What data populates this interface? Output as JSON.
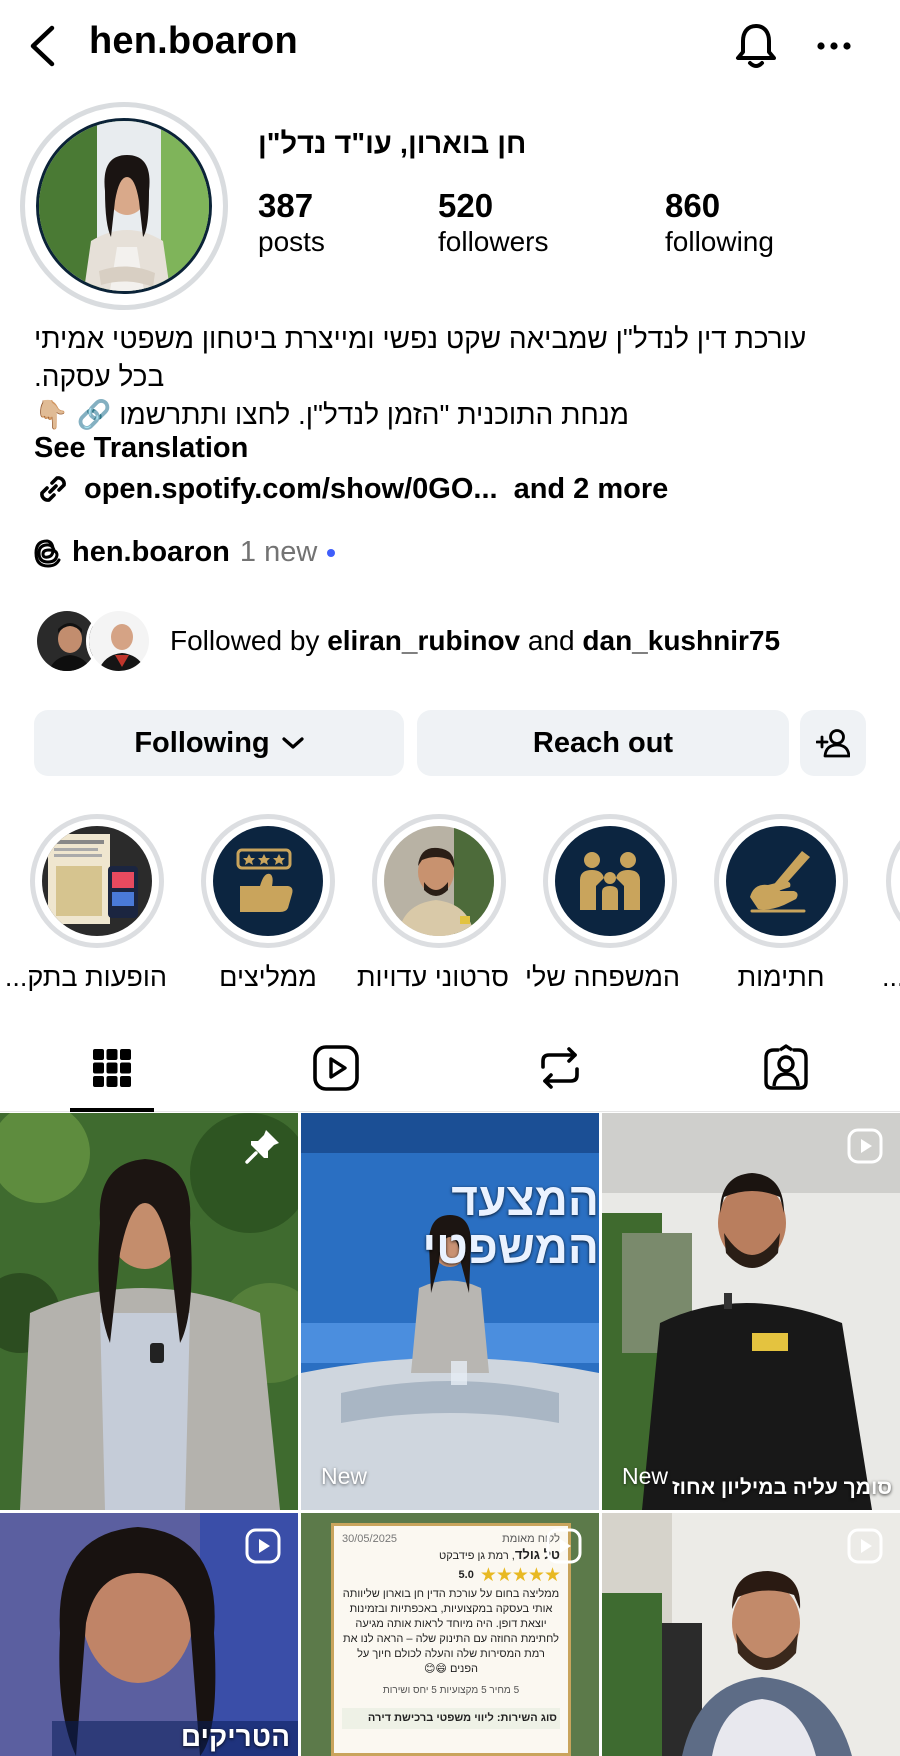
{
  "header": {
    "username": "hen.boaron"
  },
  "profile": {
    "display_name": "חן בוארון, עו\"ד נדל\"ן",
    "stats": [
      {
        "value": "387",
        "label": "posts"
      },
      {
        "value": "520",
        "label": "followers"
      },
      {
        "value": "860",
        "label": "following"
      }
    ],
    "bio_lines": [
      "עורכת דין לנדל\"ן שמביאה שקט נפשי ומייצרת ביטחון משפטי אמיתי",
      "בכל עסקה.",
      "מנחת התוכנית \"הזמן לנדל\"ן. לחצו ותתרשמו 🔗 👇🏼"
    ],
    "see_translation": "See Translation",
    "link_text": "open.spotify.com/show/0GO...",
    "link_more": "and 2 more",
    "threads_handle": "hen.boaron",
    "threads_new": "1 new"
  },
  "followed_by": {
    "prefix": "Followed by",
    "user1": "eliran_rubinov",
    "conj": "and",
    "user2": "dan_kushnir75"
  },
  "actions": {
    "following": "Following",
    "reach_out": "Reach out"
  },
  "highlights": [
    {
      "label": "הופעות בתק..."
    },
    {
      "label": "ממליצים"
    },
    {
      "label": "סרטוני עדויות"
    },
    {
      "label": "המשפחה שלי"
    },
    {
      "label": "חתימות"
    },
    {
      "label": "..."
    }
  ],
  "grid": {
    "post2_badge": "New",
    "post3_badge": "New",
    "post3_caption": "סומך עליה במיליון אחוז",
    "post2_banner": "המצעד המשפטי",
    "post4_caption": "הטריקים והשטיקים",
    "post5": {
      "date": "30/05/2025",
      "verified": "לקוח מאומת",
      "name": "טל גולד",
      "meta": ", רמת גן  פידבקט",
      "rating": "5.0",
      "text": "ממליצה בחום על עורכת הדין חן בוארון שליוותה אותי בעסקה במקצועיות, באכפתיות ובזמינות יוצאת דופן. היה מיוחד לראות אותה מגיעה לחתימת החוזה עם התינוק שלה – הראה לנו את רמת המסירות שלה והעלה לכולם חיוך על הפנים 😄😊",
      "scores": "5 מחיר  5 מקצועיות  5 יחס ושירות",
      "service": "סוג השירות: ליווי משפטי ברכישת דירה"
    }
  },
  "colors": {
    "navy": "#0c2540",
    "gold": "#c9a45c",
    "button_bg": "#eff2f5",
    "new_dot": "#3f5efb"
  }
}
